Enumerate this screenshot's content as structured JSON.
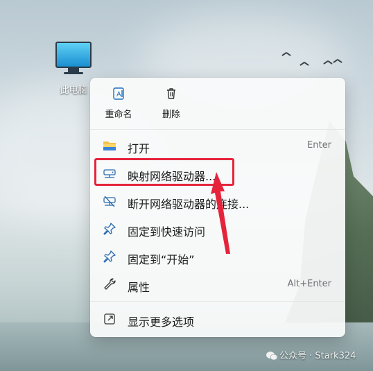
{
  "desktop": {
    "icon_label": "此电脑"
  },
  "context_menu": {
    "quick_actions": [
      {
        "label": "重命名",
        "icon": "rename-icon"
      },
      {
        "label": "删除",
        "icon": "trash-icon"
      }
    ],
    "items": [
      {
        "label": "打开",
        "shortcut": "Enter",
        "icon": "folder-icon"
      },
      {
        "label": "映射网络驱动器...",
        "shortcut": "",
        "icon": "map-network-drive-icon",
        "highlighted": true
      },
      {
        "label": "断开网络驱动器的连接...",
        "shortcut": "",
        "icon": "disconnect-network-drive-icon"
      },
      {
        "label": "固定到快速访问",
        "shortcut": "",
        "icon": "pin-icon"
      },
      {
        "label": "固定到“开始”",
        "shortcut": "",
        "icon": "pin-icon"
      },
      {
        "label": "属性",
        "shortcut": "Alt+Enter",
        "icon": "wrench-icon"
      },
      {
        "label": "显示更多选项",
        "shortcut": "",
        "icon": "more-options-icon"
      }
    ]
  },
  "annotation": {
    "highlight_color": "#e5243b"
  },
  "watermark": {
    "text": "公众号 · Stark324"
  }
}
